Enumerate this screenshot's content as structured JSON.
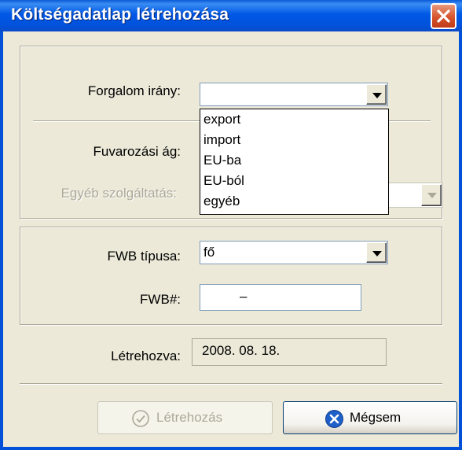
{
  "window": {
    "title": "Költségadatlap létrehozása",
    "close_icon": "close-icon"
  },
  "traffic": {
    "label": "Forgalom irány:",
    "value": "",
    "options": [
      "export",
      "import",
      "EU-ba",
      "EU-ból",
      "egyéb"
    ]
  },
  "transport": {
    "label": "Fuvarozási ág:"
  },
  "other_service": {
    "label": "Egyéb szolgáltatás:",
    "value": ""
  },
  "fwb": {
    "type_label": "FWB típusa:",
    "type_value": "fő",
    "number_label": "FWB#:",
    "number_value": "–"
  },
  "created": {
    "label": "Létrehozva:",
    "value": "2008. 08. 18."
  },
  "buttons": {
    "create_label": "Létrehozás",
    "create_icon": "check-circle-icon",
    "cancel_label": "Mégsem",
    "cancel_icon": "x-circle-icon"
  },
  "colors": {
    "titlebar": "#0058E6",
    "close": "#D6542E",
    "cancel_icon": "#1F5FC8"
  }
}
